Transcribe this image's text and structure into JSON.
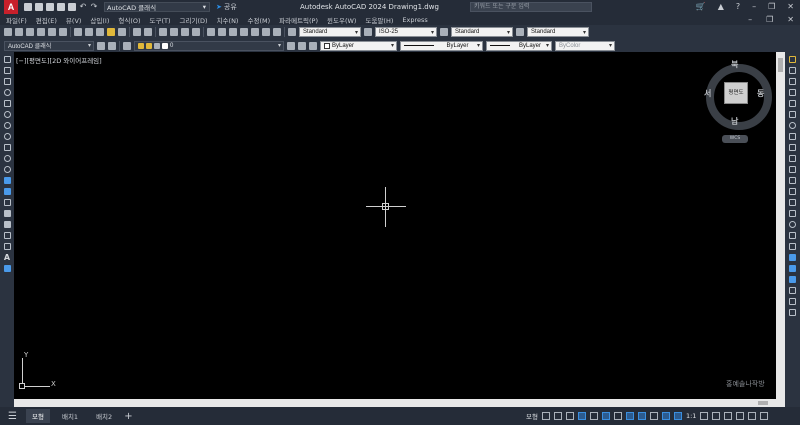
{
  "title_bar": {
    "app_icon": "A",
    "workspace": "AutoCAD 클래식",
    "share_label": "공유",
    "window_title": "Autodesk AutoCAD 2024    Drawing1.dwg",
    "search_placeholder": "키워드 또는 구문 입력",
    "icons": [
      "new-icon",
      "open-icon",
      "save-icon",
      "save-as-icon",
      "print-icon",
      "undo-icon",
      "redo-icon",
      "share-icon",
      "cart-icon",
      "user-icon",
      "help-icon",
      "minimize-icon",
      "maximize-icon",
      "close-icon"
    ]
  },
  "menu": {
    "items": [
      "파일(F)",
      "편집(E)",
      "뷰(V)",
      "삽입(I)",
      "형식(O)",
      "도구(T)",
      "그리기(D)",
      "치수(N)",
      "수정(M)",
      "파라메트릭(P)",
      "윈도우(W)",
      "도움말(H)",
      "Express"
    ]
  },
  "toolbar": {
    "text_style": "Standard",
    "dim_style": "ISO-25",
    "table_style": "Standard",
    "multileader_style": "Standard",
    "workspace_combo": "AutoCAD 클래식",
    "layer_value": "0",
    "color": "ByLayer",
    "linetype": "ByLayer",
    "lineweight": "ByLayer",
    "plot_style": "ByColor"
  },
  "viewport": {
    "label": "[−][평면도][2D 와이어프레임]",
    "viewcube": {
      "face": "평면도",
      "north": "북",
      "south": "남",
      "east": "동",
      "west": "서",
      "wcs": "WCS"
    },
    "ucs_x": "X",
    "ucs_y": "Y",
    "watermark": "홍예솔나작방"
  },
  "status": {
    "tabs": [
      "모형",
      "배치1",
      "배치2"
    ],
    "model_label": "모형",
    "scale": "1:1"
  }
}
